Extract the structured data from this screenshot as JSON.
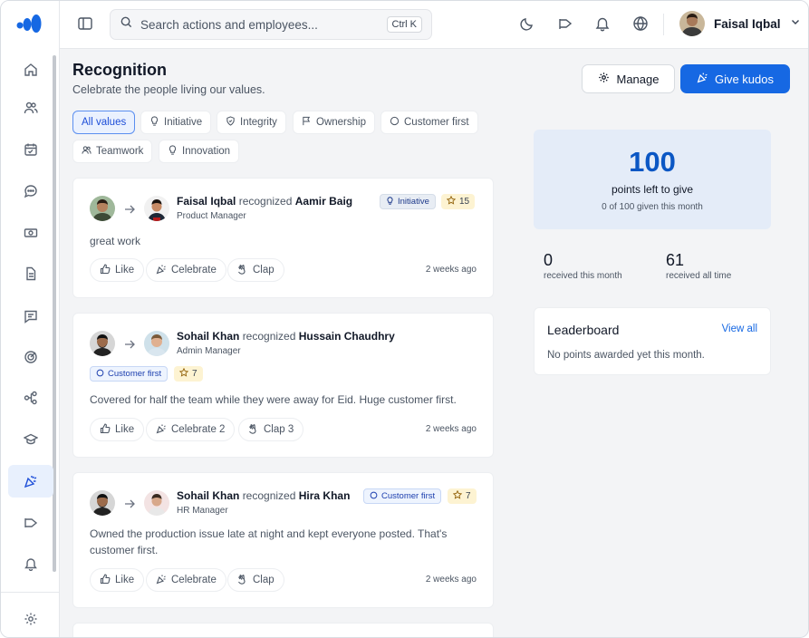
{
  "topbar": {
    "search_placeholder": "Search actions and employees...",
    "shortcut": "Ctrl K",
    "user_name": "Faisal Iqbal"
  },
  "page": {
    "title": "Recognition",
    "subtitle": "Celebrate the people living our values.",
    "manage_label": "Manage",
    "give_kudos_label": "Give kudos"
  },
  "filters": [
    {
      "label": "All values",
      "icon": "none",
      "active": true
    },
    {
      "label": "Initiative",
      "icon": "bulb-icon"
    },
    {
      "label": "Integrity",
      "icon": "shield-icon"
    },
    {
      "label": "Ownership",
      "icon": "flag-icon"
    },
    {
      "label": "Customer first",
      "icon": "circle-icon"
    },
    {
      "label": "Teamwork",
      "icon": "users-icon"
    },
    {
      "label": "Innovation",
      "icon": "bulb-icon"
    }
  ],
  "feed": [
    {
      "giver": "Faisal Iqbal",
      "verb": "recognized",
      "receiver": "Aamir Baig",
      "role": "Product Manager",
      "value": "Initiative",
      "points": "15",
      "message": "great work",
      "like": "Like",
      "celebrate": "Celebrate",
      "clap": "Clap",
      "time": "2 weeks ago"
    },
    {
      "giver": "Sohail Khan",
      "verb": "recognized",
      "receiver": "Hussain Chaudhry",
      "role": "Admin Manager",
      "value": "Customer first",
      "points": "7",
      "message": "Covered for half the team while they were away for Eid. Huge customer first.",
      "like": "Like",
      "celebrate": "Celebrate 2",
      "clap": "Clap 3",
      "time": "2 weeks ago"
    },
    {
      "giver": "Sohail Khan",
      "verb": "recognized",
      "receiver": "Hira Khan",
      "role": "HR Manager",
      "value": "Customer first",
      "points": "7",
      "message": "Owned the production issue late at night and kept everyone posted. That's customer first.",
      "like": "Like",
      "celebrate": "Celebrate",
      "clap": "Clap",
      "time": "2 weeks ago"
    }
  ],
  "points": {
    "left": "100",
    "label": "points left to give",
    "sub": "0 of 100 given this month"
  },
  "stats": [
    {
      "value": "0",
      "label": "received this month"
    },
    {
      "value": "61",
      "label": "received all time"
    }
  ],
  "leaderboard": {
    "title": "Leaderboard",
    "link": "View all",
    "empty": "No points awarded yet this month."
  },
  "colors": {
    "accent": "#1668e3",
    "active_nav_bg": "#e8f0fd",
    "points_bg": "#e4ecf8",
    "points_badge": "#fdf3d2"
  }
}
